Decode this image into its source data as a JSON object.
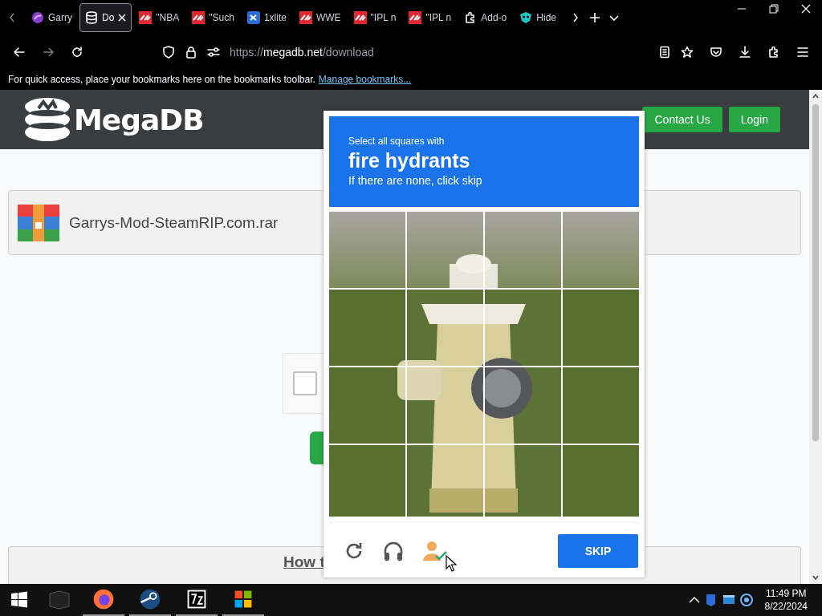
{
  "browser": {
    "tabs": [
      {
        "label": "Garry",
        "kind": "orb",
        "selected": false
      },
      {
        "label": "Do",
        "kind": "database",
        "selected": true
      },
      {
        "label": "\"NBA",
        "kind": "sk",
        "selected": false
      },
      {
        "label": "\"Such",
        "kind": "sk",
        "selected": false
      },
      {
        "label": "1xlite",
        "kind": "ix",
        "selected": false
      },
      {
        "label": "WWE",
        "kind": "sk",
        "selected": false
      },
      {
        "label": "\"IPL n",
        "kind": "sk",
        "selected": false
      },
      {
        "label": "\"IPL n",
        "kind": "sk",
        "selected": false
      },
      {
        "label": "Add-o",
        "kind": "puzzle",
        "selected": false
      },
      {
        "label": "Hide",
        "kind": "mask",
        "selected": false
      }
    ],
    "url": {
      "scheme": "https://",
      "host": "megadb.net",
      "path": "/download"
    },
    "bookmarks_bar": {
      "message": "For quick access, place your bookmarks here on the bookmarks toolbar.",
      "link": "Manage bookmarks..."
    }
  },
  "page": {
    "logo": "MegaDB",
    "nav_buttons": [
      "Contact Us",
      "Login"
    ],
    "file_name": "Garrys-Mod-SteamRIP.com.rar",
    "verify_checkbox": {
      "checked": false
    },
    "how_to_heading": "How t"
  },
  "captcha": {
    "prompt": "Select all squares with",
    "target": "fire hydrants",
    "hint": "If there are none, click skip",
    "button": "SKIP"
  },
  "taskbar": {
    "time": "11:49 PM",
    "date": "8/22/2024"
  }
}
